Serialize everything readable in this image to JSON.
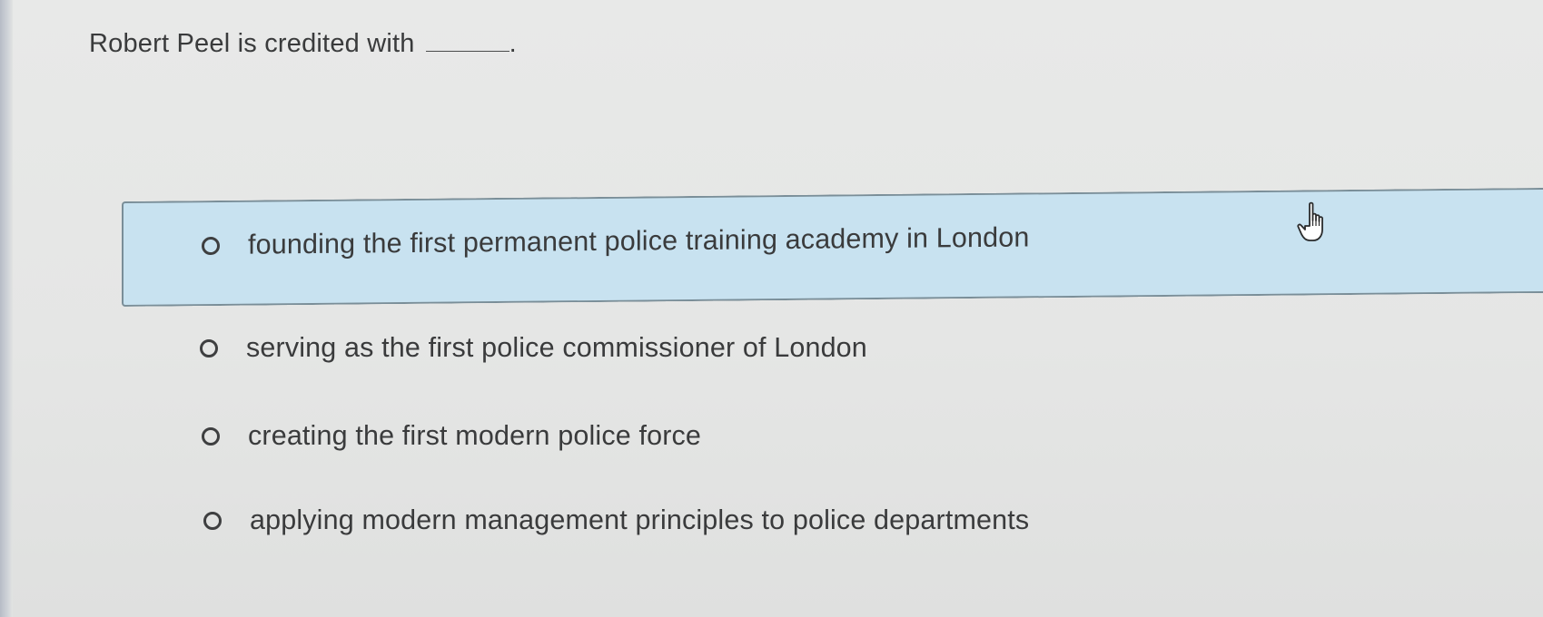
{
  "question": {
    "text": "Robert Peel is credited with",
    "blank_suffix": "."
  },
  "options": [
    {
      "label": "founding the first permanent police training academy in London",
      "selected": false,
      "hovered": true
    },
    {
      "label": "serving as the first police commissioner of London",
      "selected": false,
      "hovered": false
    },
    {
      "label": "creating the first modern police force",
      "selected": false,
      "hovered": false
    },
    {
      "label": "applying modern management principles to police departments",
      "selected": false,
      "hovered": false
    }
  ],
  "colors": {
    "background": "#e6e7e6",
    "hover_highlight": "#c8e2f0",
    "hover_border": "#7a8e98",
    "text": "#3a3b3c"
  },
  "cursor": {
    "icon": "hand-pointer-icon"
  }
}
